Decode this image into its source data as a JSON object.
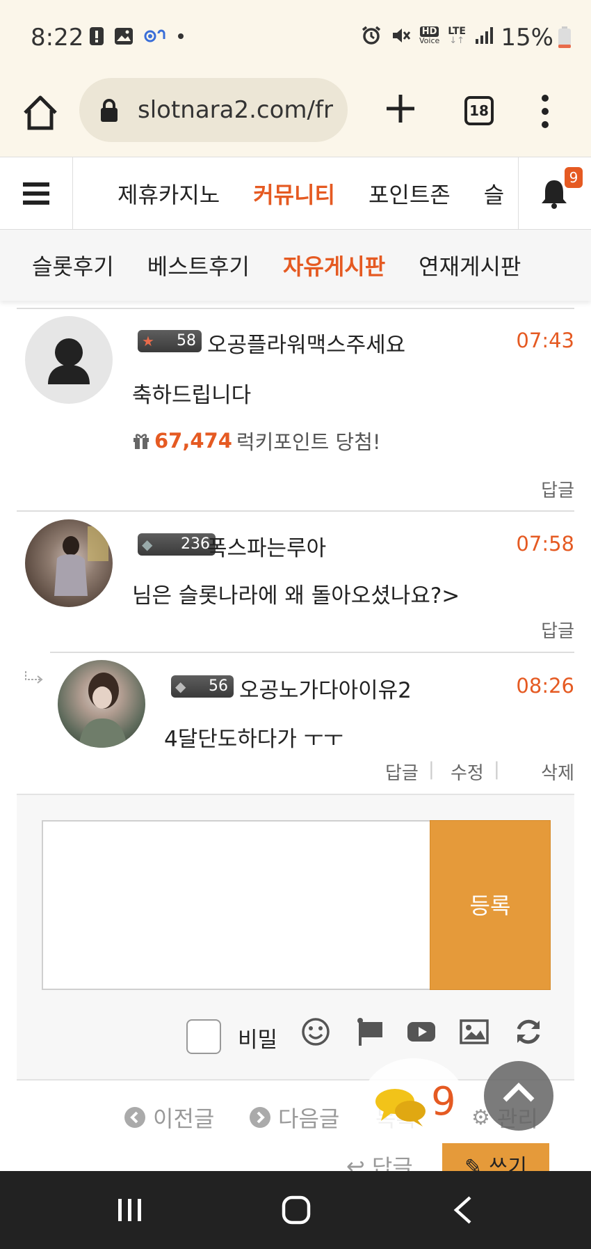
{
  "status_bar": {
    "time": "8:22",
    "battery": "15%",
    "icons": [
      "alert-icon",
      "image-icon",
      "link-icon",
      "dot-icon",
      "alarm-icon",
      "mute-icon",
      "hd-voice-icon",
      "lte-icon",
      "signal-icon",
      "battery-icon"
    ],
    "hd_label": "HD",
    "voice_label": "Voice",
    "lte_label": "LTE"
  },
  "browser": {
    "url": "slotnara2.com/fr",
    "tab_count": "18"
  },
  "site_nav": {
    "items": [
      {
        "label": "제휴카지노",
        "active": false
      },
      {
        "label": "커뮤니티",
        "active": true
      },
      {
        "label": "포인트존",
        "active": false
      },
      {
        "label": "슬",
        "active": false
      }
    ],
    "notification_count": "9"
  },
  "sub_nav": {
    "items": [
      {
        "label": "슬롯후기",
        "active": false
      },
      {
        "label": "베스트후기",
        "active": false
      },
      {
        "label": "자유게시판",
        "active": true
      },
      {
        "label": "연재게시판",
        "active": false
      }
    ]
  },
  "comments": [
    {
      "level": "58",
      "nickname": "오공플라워맥스주세요",
      "time": "07:43",
      "text": "축하드립니다",
      "lucky_points": "67,474",
      "lucky_label": "럭키포인트 당첨!",
      "reply_label": "답글"
    },
    {
      "level": "236",
      "nickname": "폭스파는루아",
      "time": "07:58",
      "text": "님은 슬롯나라에 왜 돌아오셨나요?>",
      "reply_label": "답글"
    },
    {
      "level": "56",
      "nickname": "오공노가다아이유2",
      "time": "08:26",
      "text": "4달단도하다가 ㅜㅜ",
      "reply_label": "답글",
      "edit_label": "수정",
      "delete_label": "삭제",
      "separator": "|"
    }
  ],
  "comment_form": {
    "submit_label": "등록",
    "secret_label": "비밀",
    "tools": [
      "emoji-icon",
      "flag-icon",
      "youtube-icon",
      "image-icon",
      "refresh-icon"
    ]
  },
  "bottom_links": {
    "prev_label": "이전글",
    "next_label": "다음글",
    "list_label": "목록",
    "manage_label": "관리",
    "reply_label": "답글",
    "write_label": "쓰기"
  },
  "chat": {
    "count": "9"
  },
  "colors": {
    "accent": "#e55a22",
    "button": "#e59a3a",
    "status_bg": "#fbf6ea"
  }
}
